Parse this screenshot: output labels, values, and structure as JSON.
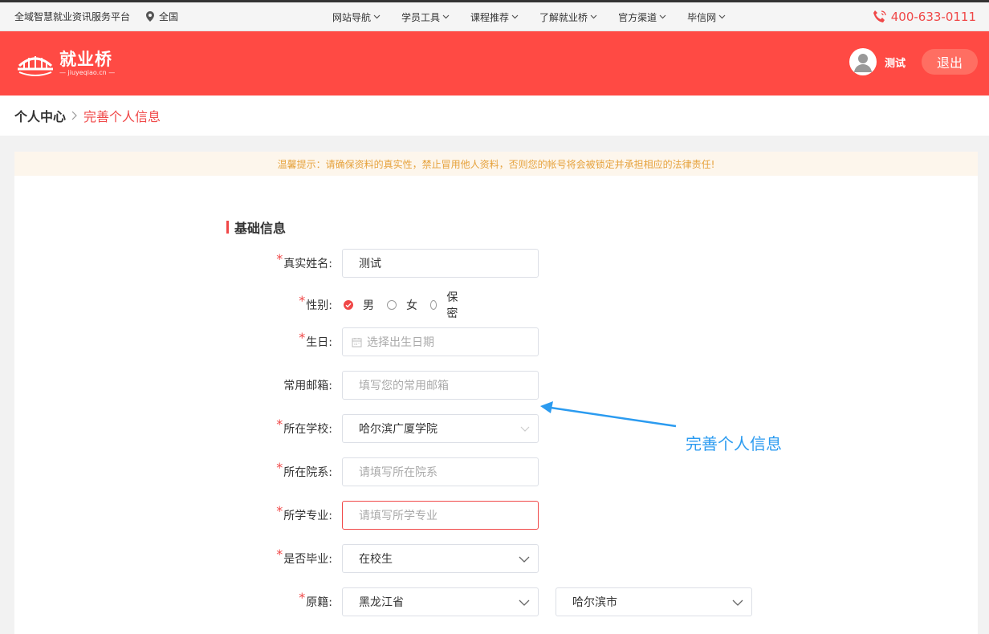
{
  "topbar": {
    "platform_name": "全域智慧就业资讯服务平台",
    "region": "全国",
    "nav": [
      "网站导航",
      "学员工具",
      "课程推荐",
      "了解就业桥",
      "官方渠道",
      "毕信网"
    ],
    "phone": "400-633-0111"
  },
  "header": {
    "logo_text": "就业桥",
    "logo_sub": "— jiuyeqiao.cn —",
    "username": "测试",
    "logout_label": "退出"
  },
  "breadcrumb": {
    "home": "个人中心",
    "current": "完善个人信息"
  },
  "notice": "温馨提示：请确保资料的真实性，禁止冒用他人资料，否则您的帐号将会被锁定并承担相应的法律责任!",
  "form": {
    "section_title": "基础信息",
    "required_mark": "*",
    "name": {
      "label": "真实姓名:",
      "value": "测试"
    },
    "gender": {
      "label": "性别:",
      "options": [
        "男",
        "女",
        "保密"
      ],
      "selected": "男"
    },
    "birthday": {
      "label": "生日:",
      "placeholder": "选择出生日期"
    },
    "email": {
      "label": "常用邮箱:",
      "placeholder": "填写您的常用邮箱"
    },
    "school": {
      "label": "所在学校:",
      "value": "哈尔滨广厦学院"
    },
    "department": {
      "label": "所在院系:",
      "placeholder": "请填写所在院系"
    },
    "major": {
      "label": "所学专业:",
      "placeholder": "请填写所学专业"
    },
    "graduated": {
      "label": "是否毕业:",
      "value": "在校生"
    },
    "origin": {
      "label": "原籍:",
      "province": "黑龙江省",
      "city": "哈尔滨市"
    }
  },
  "annotation": "完善个人信息",
  "colors": {
    "brand": "#ff4a44",
    "accent_red": "#f04848",
    "annotation_blue": "#2b9bf0"
  },
  "icons": [
    "location-pin-icon",
    "chevron-down-icon",
    "phone-icon",
    "logo-bridge-icon",
    "user-avatar-icon",
    "calendar-icon",
    "chevron-right-icon"
  ]
}
